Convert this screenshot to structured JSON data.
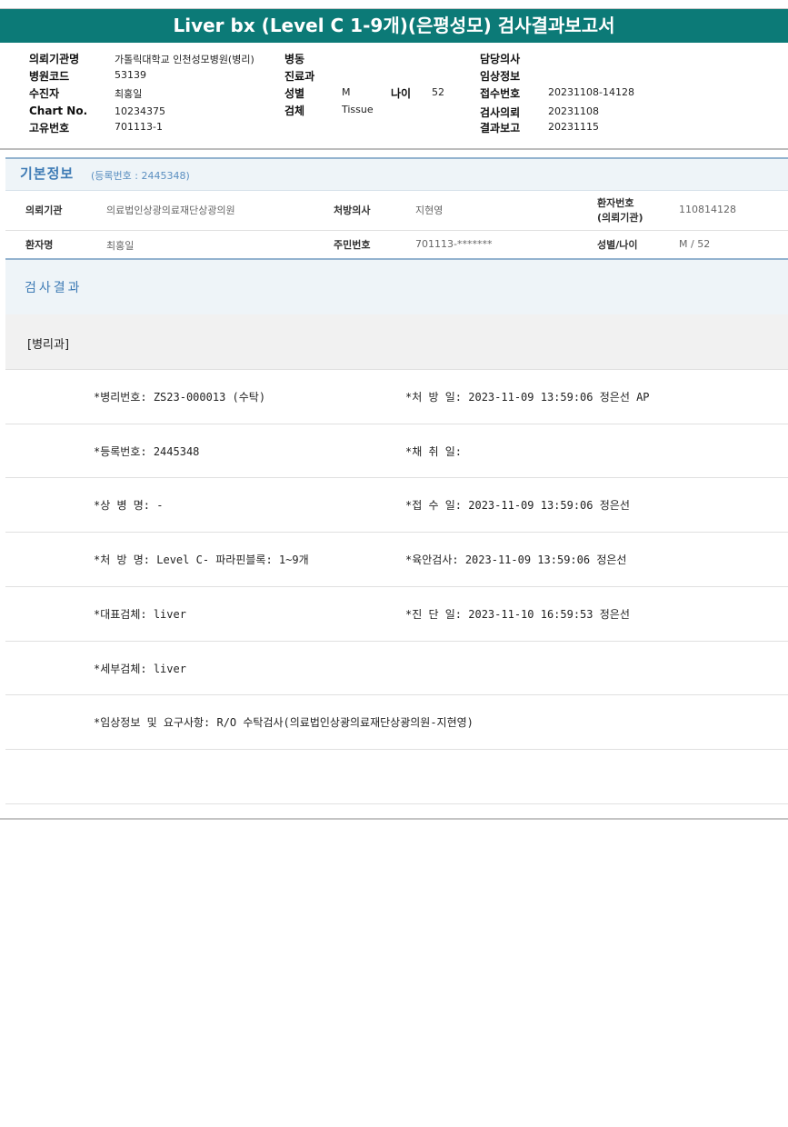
{
  "report": {
    "title": "Liver bx (Level C 1-9개)(은평성모) 검사결과보고서"
  },
  "header": {
    "rows": [
      {
        "l1": "의뢰기관명",
        "v1": "가톨릭대학교 인천성모병원(병리)",
        "l2": "병동",
        "v2": "",
        "l4": "담당의사",
        "v4": ""
      },
      {
        "l1": "병원코드",
        "v1": "53139",
        "l2": "진료과",
        "v2": "",
        "l4": "임상정보",
        "v4": ""
      },
      {
        "l1": "수진자",
        "v1": "최홍일",
        "l2": "성별",
        "v2": "M",
        "l3": "나이",
        "v3": "52",
        "l4": "접수번호",
        "v4": "20231108-14128"
      },
      {
        "l1": "Chart No.",
        "v1": "10234375",
        "l2": "검체",
        "v2": "Tissue",
        "l4": "검사의뢰",
        "v4": "20231108"
      },
      {
        "l1": "고유번호",
        "v1": "701113-1",
        "l2": "",
        "v2": "",
        "l4": "결과보고",
        "v4": "20231115"
      }
    ]
  },
  "basic_info": {
    "title": "기본정보",
    "subtitle": "(등록번호 : 2445348)",
    "institution_label": "의뢰기관",
    "institution_value": "의료법인상광의료재단상광의원",
    "doctor_label": "처방의사",
    "doctor_value": "지현영",
    "patient_no_label_1": "환자번호",
    "patient_no_label_2": "(의뢰기관)",
    "patient_no_value": "110814128",
    "patient_name_label": "환자명",
    "patient_name_value": "최홍일",
    "rrn_label": "주민번호",
    "rrn_value": "701113-*******",
    "sex_age_label": "성별/나이",
    "sex_age_value": "M / 52"
  },
  "results": {
    "title": "검사결과",
    "department": "[병리과]",
    "rows": [
      {
        "left": "*병리번호: ZS23-000013 (수탁)",
        "right": "*처 방 일: 2023-11-09 13:59:06  정은선 AP"
      },
      {
        "left": "*등록번호: 2445348",
        "right": "*채 취 일:"
      },
      {
        "left": "*상 병 명: -",
        "right": "*접 수 일: 2023-11-09 13:59:06  정은선"
      },
      {
        "left": "*처 방 명: Level C- 파라핀블록: 1~9개",
        "right": "*육안검사: 2023-11-09 13:59:06  정은선"
      },
      {
        "left": "*대표검체: liver",
        "right": "*진 단 일: 2023-11-10 16:59:53  정은선"
      },
      {
        "left": "*세부검체: liver",
        "right": ""
      },
      {
        "left": "*임상정보 및 요구사항: R/O 수탁검사(의료법인상광의료재단상광의원-지현영)",
        "right": ""
      }
    ]
  }
}
